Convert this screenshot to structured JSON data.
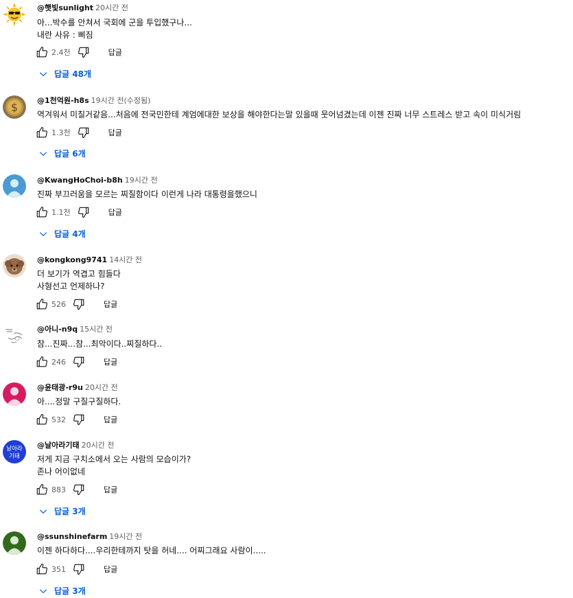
{
  "comments": [
    {
      "author": "@햇빛sunlight",
      "time": "20시간 전",
      "text": "아...박수를 안쳐서 국회에 군을 투입했구나...\n내란 사유 : 삐짐",
      "likes": "2.4천",
      "reply": "답글",
      "replies": "답글 48개",
      "avatar": "sun-avatar"
    },
    {
      "author": "@1천억원-h8s",
      "time": "19시간 전(수정됨)",
      "text": "역겨워서 미칠거같음...처음에 전국민한테 계엄에대한 보상을 해야한다는말 있을때 웃어넘겼는데 이젠 진짜 너무 스트레스 받고 속이 미식거림",
      "likes": "1.3천",
      "reply": "답글",
      "replies": "답글 6개",
      "avatar": "coin-avatar"
    },
    {
      "author": "@KwangHoChoi-b8h",
      "time": "19시간 전",
      "text": "진짜 부끄러움을 모르는 찌질함이다 이런게 나라 대통령을했으니",
      "likes": "1.1천",
      "reply": "답글",
      "replies": "답글 4개",
      "avatar": "default-avatar"
    },
    {
      "author": "@kongkong9741",
      "time": "14시간 전",
      "text": "더 보기가 역겹고 힘들다\n사형선고 언제하나?",
      "likes": "526",
      "reply": "답글",
      "avatar": "dog-avatar"
    },
    {
      "author": "@아니-n9q",
      "time": "15시간 전",
      "text": "참...진짜...참...최악이다..찌질하다..",
      "likes": "246",
      "reply": "답글",
      "avatar": "sketch-avatar"
    },
    {
      "author": "@윤태광-r9u",
      "time": "20시간 전",
      "text": "아....정말 구질구질하다.",
      "likes": "532",
      "reply": "답글",
      "avatar": "pink-avatar"
    },
    {
      "author": "@날아라기태",
      "time": "20시간 전",
      "text": "저게 지금 구치소에서 오는 사람의 모습이가?\n존나 어이없네",
      "likes": "883",
      "reply": "답글",
      "replies": "답글 3개",
      "avatar": "blue-text-avatar",
      "avatar_text": "날아라\n기태"
    },
    {
      "author": "@ssunshinefarm",
      "time": "19시간 전",
      "text": "이젠 하다하다....우리한테까지 탓을 허네.... 어찌그래요 사람이.....",
      "likes": "351",
      "reply": "답글",
      "replies": "답글 3개",
      "avatar": "green-avatar"
    }
  ],
  "colors": {
    "link": "#065fd4",
    "secondary": "#606060",
    "primary": "#0f0f0f"
  },
  "icons": {
    "like": "thumbs-up-icon",
    "dislike": "thumbs-down-icon",
    "expand": "chevron-down-icon"
  }
}
